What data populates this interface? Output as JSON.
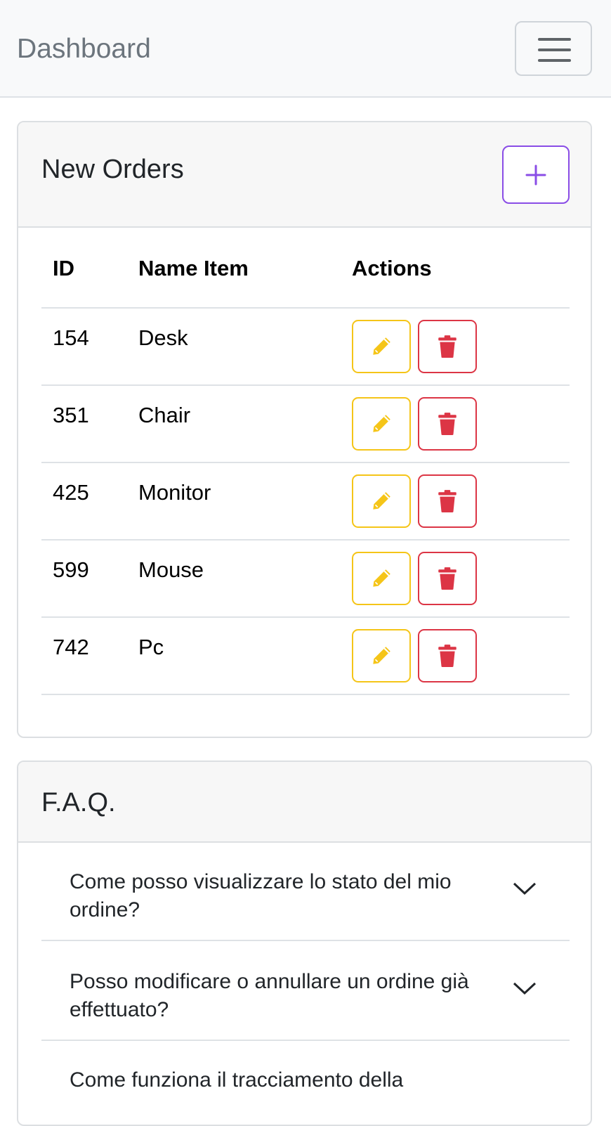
{
  "navbar": {
    "brand": "Dashboard",
    "toggler_icon": "hamburger-menu-icon"
  },
  "orders": {
    "title": "New Orders",
    "add_icon": "plus-icon",
    "columns": [
      "ID",
      "Name Item",
      "Actions"
    ],
    "rows": [
      {
        "id": "154",
        "name": "Desk"
      },
      {
        "id": "351",
        "name": "Chair"
      },
      {
        "id": "425",
        "name": "Monitor"
      },
      {
        "id": "599",
        "name": "Mouse"
      },
      {
        "id": "742",
        "name": "Pc"
      }
    ],
    "edit_icon": "pencil-icon",
    "delete_icon": "trash-icon"
  },
  "faq": {
    "title": "F.A.Q.",
    "items": [
      {
        "question": "Come posso visualizzare lo stato del mio ordine?"
      },
      {
        "question": "Posso modificare o annullare un ordine già effettuato?"
      },
      {
        "question": "Come funziona il tracciamento della"
      }
    ]
  },
  "colors": {
    "brand_text": "#6c757d",
    "add_button": "#8a4de6",
    "edit_button": "#f5c518",
    "delete_button": "#dc3545"
  }
}
